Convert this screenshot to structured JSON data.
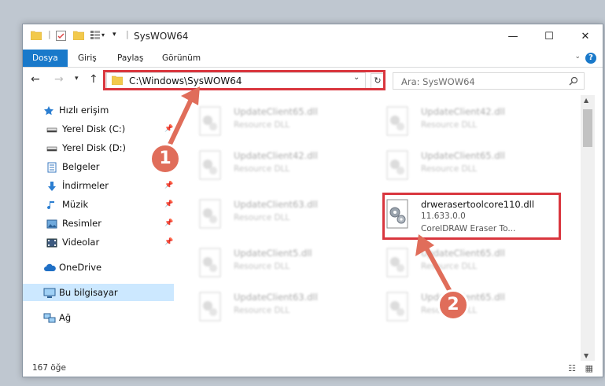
{
  "window": {
    "title": "SysWOW64"
  },
  "ribbon": {
    "tabs": [
      {
        "label": "Dosya",
        "active": true
      },
      {
        "label": "Giriş"
      },
      {
        "label": "Paylaş"
      },
      {
        "label": "Görünüm"
      }
    ]
  },
  "address_bar": {
    "path": "C:\\Windows\\SysWOW64"
  },
  "search": {
    "placeholder": "Ara: SysWOW64"
  },
  "sidebar": {
    "items": [
      {
        "label": "Hızlı erişim",
        "icon": "star-icon"
      },
      {
        "label": "Yerel Disk (C:)",
        "icon": "drive-icon",
        "pinned": true
      },
      {
        "label": "Yerel Disk (D:)",
        "icon": "drive-icon"
      },
      {
        "label": "Belgeler",
        "icon": "document-icon"
      },
      {
        "label": "İndirmeler",
        "icon": "download-icon",
        "pinned": true
      },
      {
        "label": "Müzik",
        "icon": "music-icon",
        "pinned": true
      },
      {
        "label": "Resimler",
        "icon": "pictures-icon",
        "pinned": true
      },
      {
        "label": "Videolar",
        "icon": "video-icon",
        "pinned": true
      },
      {
        "label": "OneDrive",
        "icon": "cloud-icon"
      },
      {
        "label": "Bu bilgisayar",
        "icon": "computer-icon",
        "selected": true
      },
      {
        "label": "Ağ",
        "icon": "network-icon"
      }
    ]
  },
  "files": [
    {
      "name": "UpdateClient65.dll",
      "desc": "Resource DLL",
      "blurred": true
    },
    {
      "name": "UpdateClient42.dll",
      "desc": "Resource DLL",
      "blurred": true
    },
    {
      "name": "UpdateClient42.dll",
      "desc": "Resource DLL",
      "blurred": true
    },
    {
      "name": "UpdateClient65.dll",
      "desc": "Resource DLL",
      "blurred": true
    },
    {
      "name": "UpdateClient63.dll",
      "desc": "Resource DLL",
      "blurred": true
    },
    {
      "name": "drwerasertoolcore110.dll",
      "version": "11.633.0.0",
      "desc": "CorelDRAW Eraser To...",
      "blurred": false
    },
    {
      "name": "UpdateClient5.dll",
      "desc": "Resource DLL",
      "blurred": true
    },
    {
      "name": "UpdateClient65.dll",
      "desc": "Resource DLL",
      "blurred": true
    },
    {
      "name": "UpdateClient63.dll",
      "desc": "Resource DLL",
      "blurred": true
    },
    {
      "name": "UpdateClient65.dll",
      "desc": "Resource DLL",
      "blurred": true
    }
  ],
  "status": {
    "item_count": "167 öğe"
  },
  "markers": {
    "one": "1",
    "two": "2"
  },
  "colors": {
    "accent": "#1979ca",
    "highlight": "#d9363e",
    "marker": "#e06d5a",
    "selected": "#cce8ff"
  }
}
